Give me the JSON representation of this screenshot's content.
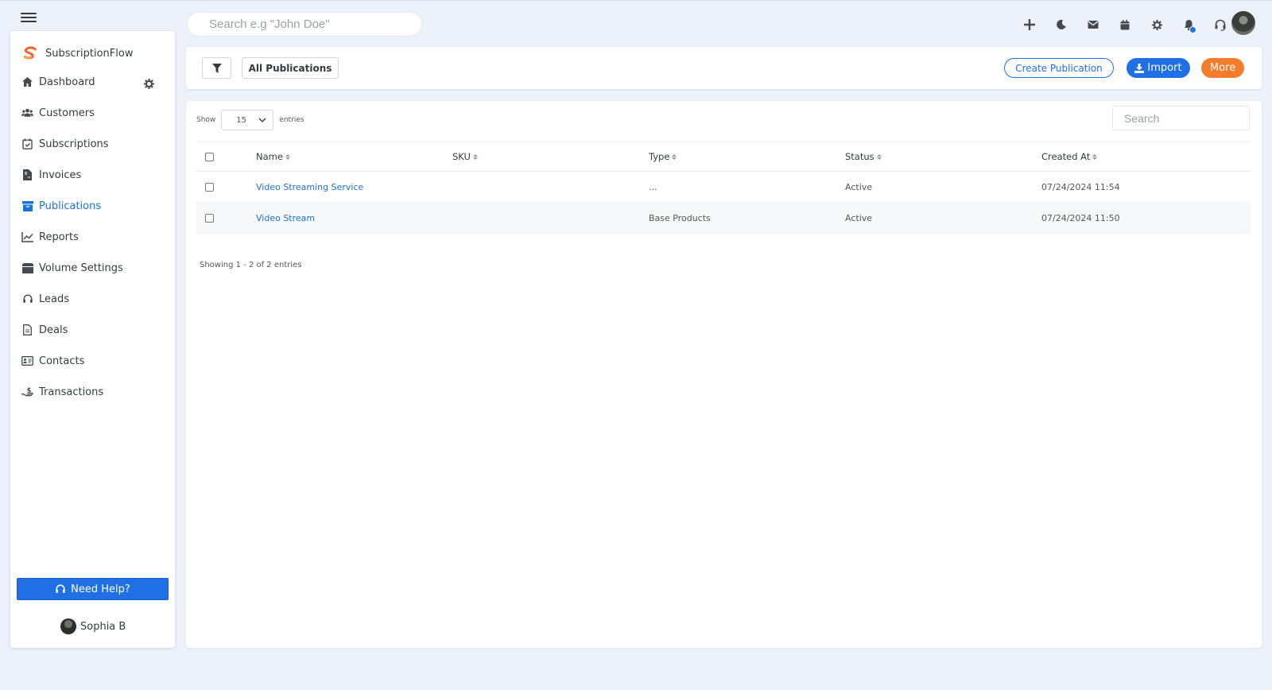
{
  "sidebar": {
    "brand": "SubscriptionFlow",
    "items": [
      {
        "label": "Dashboard",
        "icon": "home-icon"
      },
      {
        "label": "Customers",
        "icon": "users-icon"
      },
      {
        "label": "Subscriptions",
        "icon": "calendar-check-icon"
      },
      {
        "label": "Invoices",
        "icon": "invoice-icon"
      },
      {
        "label": "Publications",
        "icon": "archive-icon",
        "active": true
      },
      {
        "label": "Reports",
        "icon": "chart-line-icon"
      },
      {
        "label": "Volume Settings",
        "icon": "box-icon"
      },
      {
        "label": "Leads",
        "icon": "headset-icon"
      },
      {
        "label": "Deals",
        "icon": "document-icon"
      },
      {
        "label": "Contacts",
        "icon": "address-card-icon"
      },
      {
        "label": "Transactions",
        "icon": "hand-dollar-icon"
      }
    ],
    "help_label": "Need Help?",
    "user_name": "Sophia B"
  },
  "header": {
    "search_placeholder": "Search e.g \"John Doe\"",
    "icons": [
      "plus-icon",
      "moon-icon",
      "envelope-icon",
      "calendar-icon",
      "gear-icon",
      "bell-icon",
      "headset-icon"
    ]
  },
  "toolbar": {
    "filter_label": "All Publications",
    "create_label": "Create Publication",
    "import_label": "Import",
    "more_label": "More"
  },
  "table": {
    "show_label": "Show",
    "entries_value": "15",
    "entries_label": "entries",
    "search_placeholder": "Search",
    "columns": [
      "Name",
      "SKU",
      "Type",
      "Status",
      "Created At"
    ],
    "rows": [
      {
        "name": "Video Streaming Service",
        "sku": "",
        "type": "...",
        "status": "Active",
        "created": "07/24/2024 11:54"
      },
      {
        "name": "Video Stream",
        "sku": "",
        "type": "Base Products",
        "status": "Active",
        "created": "07/24/2024 11:50"
      }
    ],
    "footer": "Showing 1 - 2 of 2 entries"
  },
  "colors": {
    "primary": "#1f6fe5",
    "accent": "#f57c2d",
    "background": "#edf1f9"
  }
}
